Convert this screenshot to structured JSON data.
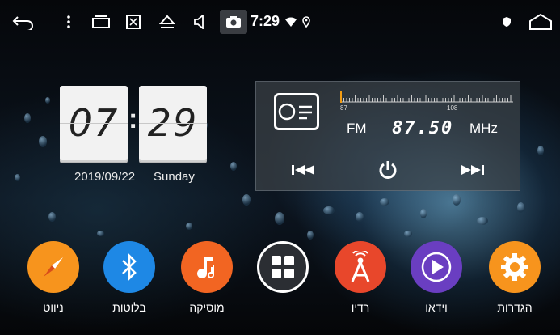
{
  "status_bar": {
    "time": "7:29",
    "icons": [
      "back-icon",
      "more-icon",
      "recent-apps-icon",
      "screenshot-icon",
      "eject-icon",
      "volume-icon",
      "camera-icon",
      "wifi-icon",
      "location-icon",
      "shield-icon",
      "home-icon"
    ]
  },
  "clock": {
    "hours": "07",
    "minutes": "29",
    "colon": ":",
    "date": "2019/09/22",
    "day": "Sunday"
  },
  "radio": {
    "band": "FM",
    "frequency": "87.50",
    "unit": "MHz",
    "scale_min": "87",
    "scale_max": "108",
    "tuner_position": 0.0,
    "controls": [
      "previous-icon",
      "power-icon",
      "next-icon"
    ]
  },
  "dock": {
    "apps": [
      {
        "label": "ניווט",
        "icon": "compass-icon",
        "color": "#f7941d"
      },
      {
        "label": "בלוטות",
        "icon": "bluetooth-icon",
        "color": "#1e88e5"
      },
      {
        "label": "מוסיקה",
        "icon": "music-icon",
        "color": "#f26522"
      },
      {
        "label": "",
        "icon": "app-grid-icon",
        "color": "#2b2e33"
      },
      {
        "label": "רדיו",
        "icon": "radio-tower-icon",
        "color": "#e8472b"
      },
      {
        "label": "וידאו",
        "icon": "play-icon",
        "color": "#6a3ec1"
      },
      {
        "label": "הגדרות",
        "icon": "gear-icon",
        "color": "#f7941d"
      }
    ]
  },
  "colors": {
    "accent_orange": "#f7941d",
    "bluetooth_blue": "#1e88e5",
    "video_purple": "#6a3ec1",
    "radio_red": "#e8472b"
  }
}
